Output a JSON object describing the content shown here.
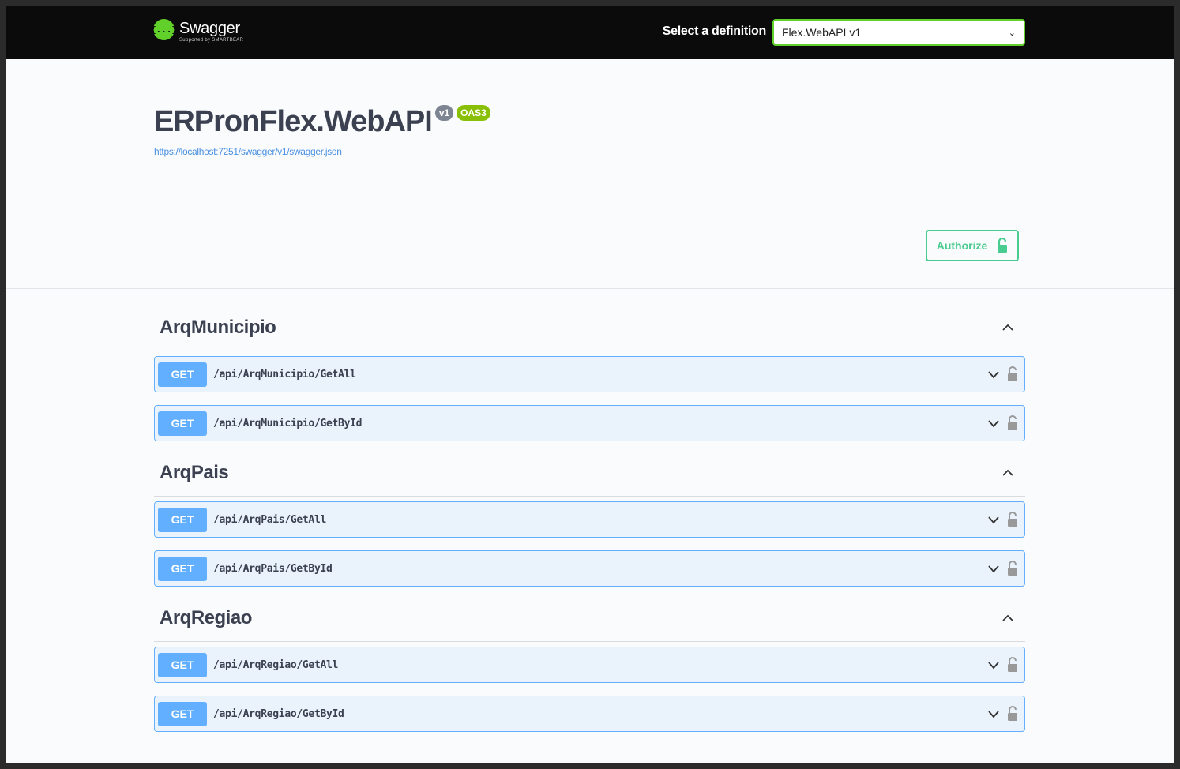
{
  "topbar": {
    "logo_icon": "{...}",
    "logo_name": "Swagger",
    "logo_sub": "Supported by SMARTBEAR",
    "definition_label": "Select a definition",
    "definition_value": "Flex.WebAPI v1"
  },
  "info": {
    "title": "ERPronFlex.WebAPI",
    "version_badge": "v1",
    "oas_badge": "OAS3",
    "spec_url": "https://localhost:7251/swagger/v1/swagger.json"
  },
  "authorize": {
    "label": "Authorize",
    "icon": "unlock-icon"
  },
  "colors": {
    "get": "#61affe",
    "accent_green": "#62d02a",
    "authorize": "#49cc90"
  },
  "tags": [
    {
      "name": "ArqMunicipio",
      "operations": [
        {
          "method": "GET",
          "path": "/api/ArqMunicipio/GetAll"
        },
        {
          "method": "GET",
          "path": "/api/ArqMunicipio/GetById"
        }
      ]
    },
    {
      "name": "ArqPais",
      "operations": [
        {
          "method": "GET",
          "path": "/api/ArqPais/GetAll"
        },
        {
          "method": "GET",
          "path": "/api/ArqPais/GetById"
        }
      ]
    },
    {
      "name": "ArqRegiao",
      "operations": [
        {
          "method": "GET",
          "path": "/api/ArqRegiao/GetAll"
        },
        {
          "method": "GET",
          "path": "/api/ArqRegiao/GetById"
        }
      ]
    }
  ]
}
